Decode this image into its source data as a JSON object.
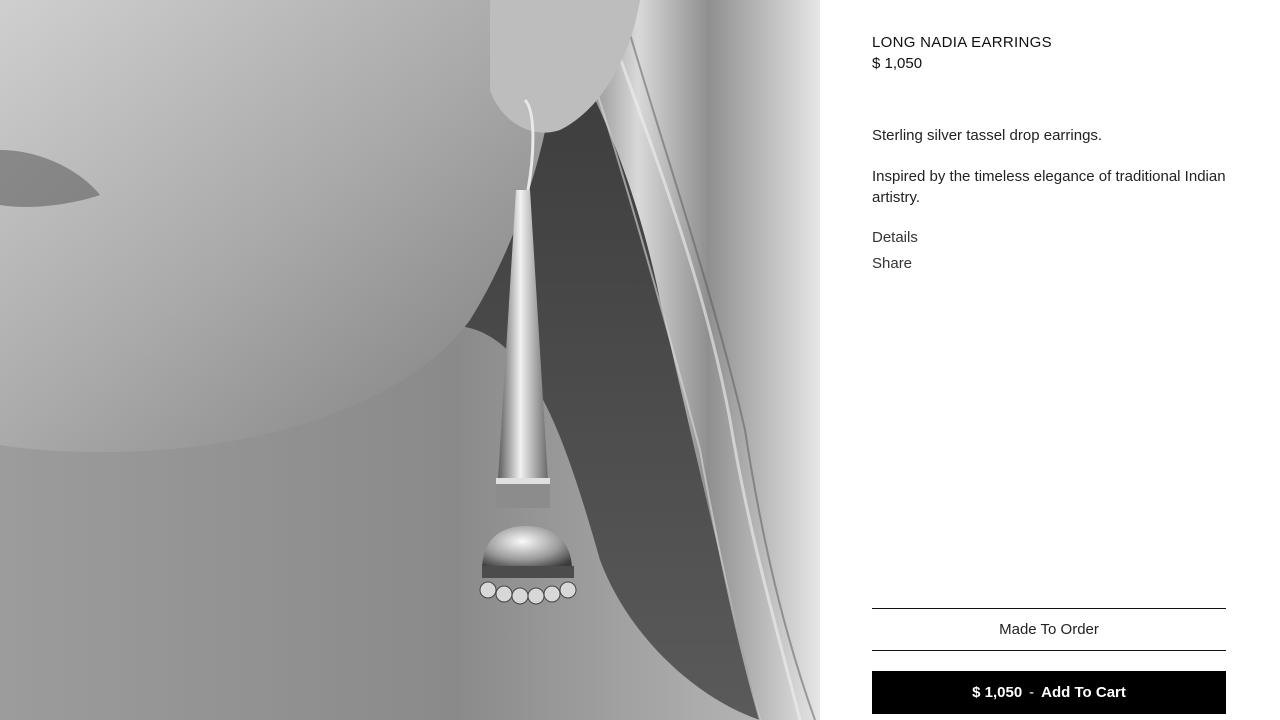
{
  "product": {
    "title": "LONG NADIA EARRINGS",
    "price": "$ 1,050",
    "description_1": "Sterling silver tassel drop earrings.",
    "description_2": "Inspired by the timeless elegance of traditional Indian artistry.",
    "details_label": "Details",
    "share_label": "Share"
  },
  "actions": {
    "made_to_order_label": "Made To Order",
    "cart_price": "$ 1,050",
    "cart_separator": "-",
    "add_to_cart_label": "Add To Cart"
  },
  "colors": {
    "button_bg": "#000000",
    "button_text": "#ffffff",
    "divider": "#111111"
  }
}
